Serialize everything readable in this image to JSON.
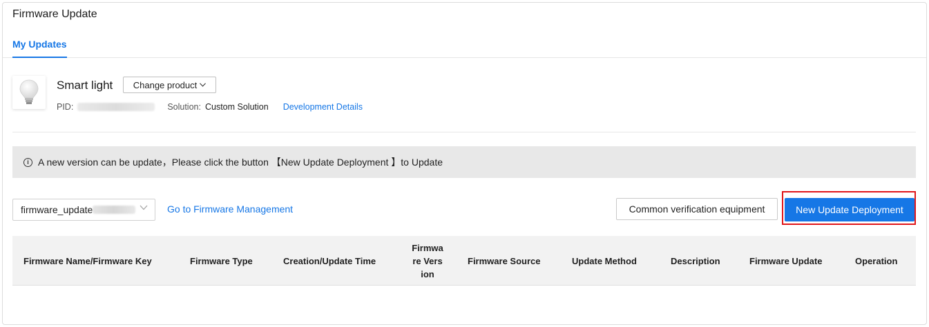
{
  "page_title": "Firmware Update",
  "tabs": [
    {
      "label": "My Updates",
      "active": true
    }
  ],
  "product": {
    "name": "Smart light",
    "change_label": "Change product",
    "pid_label": "PID:",
    "solution_label": "Solution:",
    "solution_value": "Custom Solution",
    "details_link": "Development Details"
  },
  "notice": {
    "text": "A new version can be update，Please click the button 【New Update Deployment 】to Update",
    "icon": "info-icon"
  },
  "toolbar": {
    "firmware_select_value": "firmware_update",
    "firmware_management_link": "Go to Firmware Management",
    "verify_button": "Common verification equipment",
    "new_button": "New Update Deployment"
  },
  "table": {
    "columns": [
      "Firmware Name/Firmware Key",
      "Firmware Type",
      "Creation/Update Time",
      "Firmware Version",
      "Firmware Source",
      "Update Method",
      "Description",
      "Firmware Update",
      "Operation"
    ],
    "rows": []
  },
  "colors": {
    "accent": "#1677e6",
    "highlight": "#e0161a",
    "notice_bg": "#e8e8e8"
  }
}
